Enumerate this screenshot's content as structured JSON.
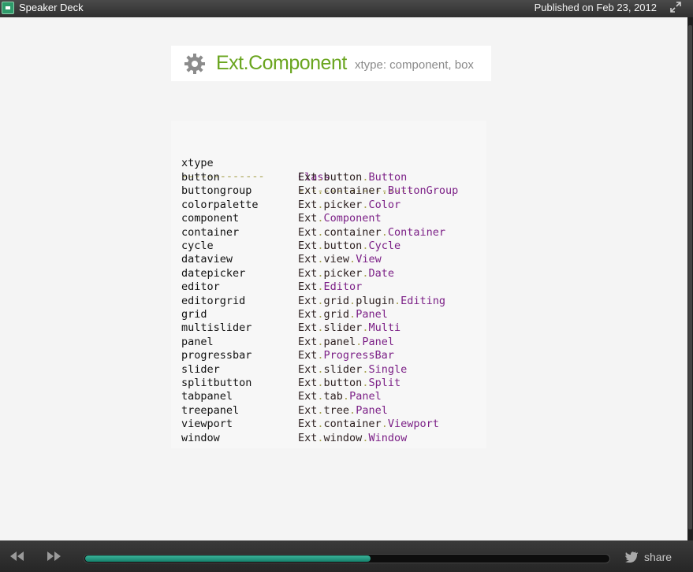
{
  "topbar": {
    "app_name": "Speaker Deck",
    "published": "Published on Feb 23, 2012"
  },
  "slide": {
    "title": "Ext.Component",
    "subtitle": "xtype: component, box",
    "header_left": "xtype",
    "header_right": "Class",
    "dashes_left": "-------------",
    "dashes_right": "------------------",
    "rows": [
      {
        "xtype": "button",
        "cls": [
          "Ext",
          "button",
          "Button"
        ]
      },
      {
        "xtype": "buttongroup",
        "cls": [
          "Ext",
          "container",
          "ButtonGroup"
        ]
      },
      {
        "xtype": "colorpalette",
        "cls": [
          "Ext",
          "picker",
          "Color"
        ]
      },
      {
        "xtype": "component",
        "cls": [
          "Ext",
          "Component"
        ]
      },
      {
        "xtype": "container",
        "cls": [
          "Ext",
          "container",
          "Container"
        ]
      },
      {
        "xtype": "cycle",
        "cls": [
          "Ext",
          "button",
          "Cycle"
        ]
      },
      {
        "xtype": "dataview",
        "cls": [
          "Ext",
          "view",
          "View"
        ]
      },
      {
        "xtype": "datepicker",
        "cls": [
          "Ext",
          "picker",
          "Date"
        ]
      },
      {
        "xtype": "editor",
        "cls": [
          "Ext",
          "Editor"
        ]
      },
      {
        "xtype": "editorgrid",
        "cls": [
          "Ext",
          "grid",
          "plugin",
          "Editing"
        ]
      },
      {
        "xtype": "grid",
        "cls": [
          "Ext",
          "grid",
          "Panel"
        ]
      },
      {
        "xtype": "multislider",
        "cls": [
          "Ext",
          "slider",
          "Multi"
        ]
      },
      {
        "xtype": "panel",
        "cls": [
          "Ext",
          "panel",
          "Panel"
        ]
      },
      {
        "xtype": "progressbar",
        "cls": [
          "Ext",
          "ProgressBar"
        ]
      },
      {
        "xtype": "slider",
        "cls": [
          "Ext",
          "slider",
          "Single"
        ]
      },
      {
        "xtype": "splitbutton",
        "cls": [
          "Ext",
          "button",
          "Split"
        ]
      },
      {
        "xtype": "tabpanel",
        "cls": [
          "Ext",
          "tab",
          "Panel"
        ]
      },
      {
        "xtype": "treepanel",
        "cls": [
          "Ext",
          "tree",
          "Panel"
        ]
      },
      {
        "xtype": "viewport",
        "cls": [
          "Ext",
          "container",
          "Viewport"
        ]
      },
      {
        "xtype": "window",
        "cls": [
          "Ext",
          "window",
          "Window"
        ]
      }
    ]
  },
  "controls": {
    "share_label": "share",
    "progress": 0.545,
    "prev_icon": "rewind-icon",
    "next_icon": "fast-forward-icon",
    "share_icon": "bird-icon"
  },
  "colors": {
    "title_green": "#6aa51f",
    "class_purple": "#7b1f86",
    "dash_olive": "#a7a24f",
    "progress_teal": "#16806b"
  }
}
